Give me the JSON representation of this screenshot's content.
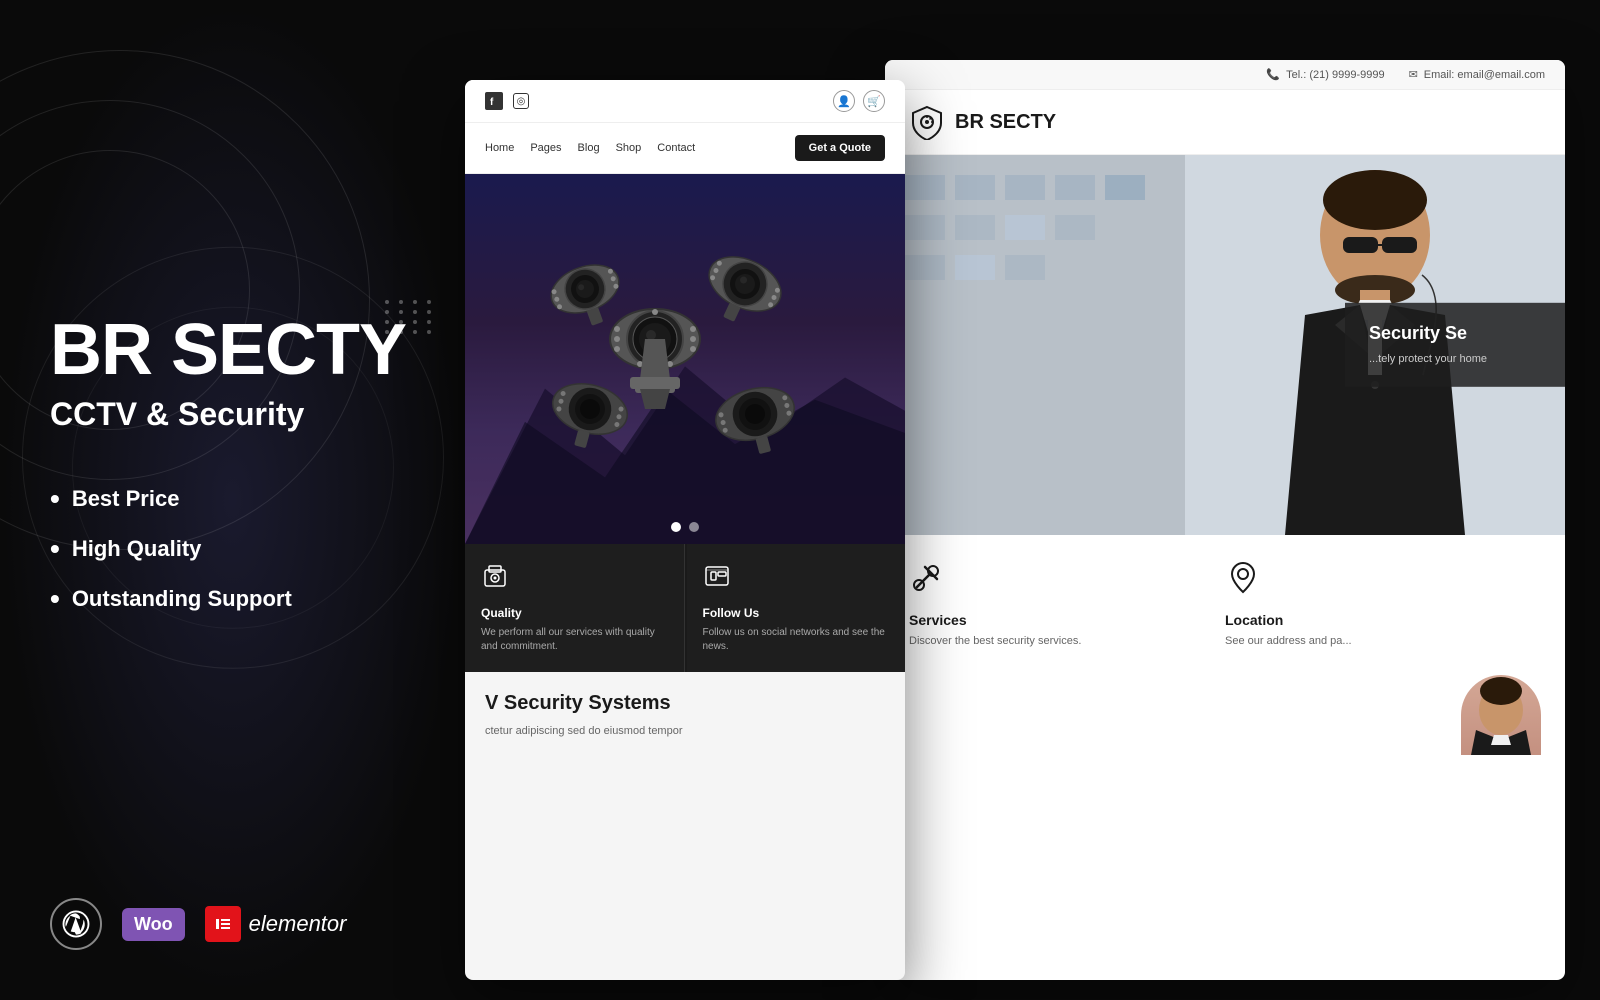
{
  "left": {
    "brand_title": "BR SECTY",
    "brand_subtitle": "CCTV & Security",
    "features": [
      "Best Price",
      "High Quality",
      "Outstanding Support"
    ],
    "logos": {
      "wordpress": "W",
      "woo": "Woo",
      "elementor_icon": "≡",
      "elementor_text": "elementor"
    }
  },
  "preview_left": {
    "social": [
      "f",
      "⊙"
    ],
    "nav_links": [
      "Home",
      "Pages",
      "Blog",
      "Shop",
      "Contact"
    ],
    "nav_cta": "Get a Quote",
    "hero_dots": [
      true,
      false
    ],
    "cards": [
      {
        "icon": "⚙",
        "title": "Quality",
        "desc": "We perform all our services with quality and commitment."
      },
      {
        "icon": "⊕",
        "title": "Follow Us",
        "desc": "Follow us on social networks and see the news."
      }
    ],
    "section_title": "V Security Systems",
    "section_text": "ctetur adipiscing sed do eiusmod tempor"
  },
  "preview_right": {
    "topbar": {
      "phone_icon": "📞",
      "phone": "Tel.: (21) 9999-9999",
      "email_icon": "✉",
      "email": "Email: email@email.com"
    },
    "brand": "BR  SECTY",
    "hero_title": "Security Se",
    "hero_sub": "...tely protect your home",
    "services": [
      {
        "icon": "🔧",
        "title": "Services",
        "desc": "Discover the best security services."
      },
      {
        "icon": "📍",
        "title": "Location",
        "desc": "See our address and pa..."
      }
    ]
  }
}
